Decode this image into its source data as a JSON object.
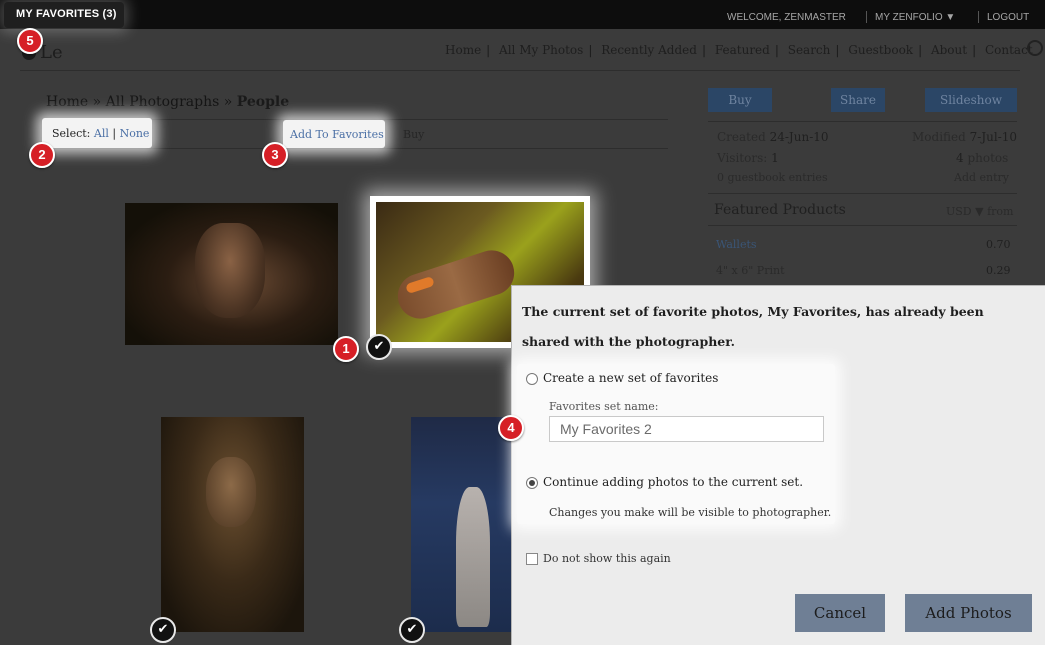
{
  "topbar": {
    "favorites_label": "MY FAVORITES (3)",
    "welcome": "WELCOME, ZENMASTER",
    "my_zenfolio": "MY ZENFOLIO ▼",
    "logout": "LOGOUT"
  },
  "header": {
    "site_name": "Le",
    "nav": [
      "Home",
      "All My Photos",
      "Recently Added",
      "Featured",
      "Search",
      "Guestbook",
      "About",
      "Contact"
    ]
  },
  "breadcrumb": {
    "home": "Home",
    "sep1": " » ",
    "all": "All Photographs",
    "sep2": " » ",
    "current": "People"
  },
  "select": {
    "label": "Select:",
    "all": "All",
    "divider": "|",
    "none": "None"
  },
  "actions": {
    "add_to_favorites": "Add To Favorites",
    "buy": "Buy"
  },
  "markers": [
    "1",
    "2",
    "3",
    "4",
    "5"
  ],
  "check_glyph": "✔",
  "panel": {
    "buy_button": "Buy",
    "share_button": "Share",
    "slideshow_button": "Slideshow",
    "created_label": "Created",
    "created_value": "24-Jun-10",
    "modified_label": "Modified",
    "modified_value": "7-Jul-10",
    "visitors_label": "Visitors:",
    "visitors_value": "1",
    "photos_count": "4",
    "photos_label": "photos",
    "guestbook_entries": "0 guestbook entries",
    "add_entry": "Add entry",
    "featured_title": "Featured Products",
    "currency": "USD ▼ from",
    "products": [
      {
        "name": "Wallets",
        "price": "0.70"
      },
      {
        "name": "4\" x 6\" Print",
        "price": "0.29"
      }
    ]
  },
  "dialog": {
    "message": "The current set of favorite photos, My Favorites, has already been shared with the photographer.",
    "option_new": "Create a new set of favorites",
    "set_name_label": "Favorites set name:",
    "set_name_value": "My Favorites 2",
    "option_continue": "Continue adding photos to the current set.",
    "changes_note": "Changes you make will be visible to photographer.",
    "do_not_show": "Do not show this again",
    "cancel": "Cancel",
    "add_photos": "Add Photos",
    "selected_option": "continue"
  },
  "colors": {
    "topbar": "#0d0d0d",
    "link": "#4a6fa5",
    "marker": "#d61f26",
    "button_dark": "#2b4666",
    "dialog_button": "#6f7f95"
  }
}
